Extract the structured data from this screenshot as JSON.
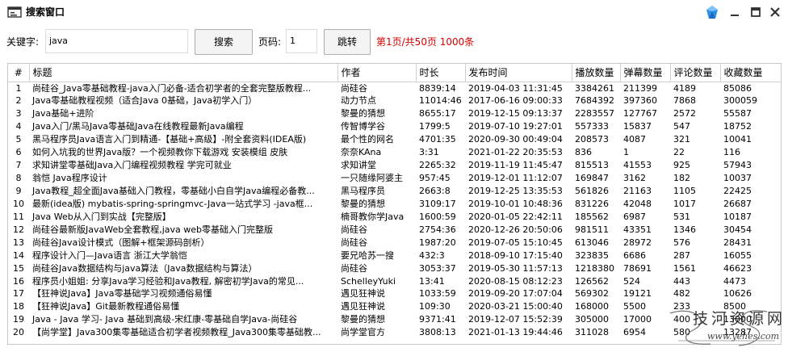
{
  "window": {
    "title": "搜索窗口"
  },
  "search": {
    "keyword_label": "关键字:",
    "keyword_value": "java",
    "search_button": "搜索",
    "page_label": "页码:",
    "page_value": "1",
    "jump_button": "跳转",
    "page_info": "第1页/共50页 1000条"
  },
  "table": {
    "columns": [
      "#",
      "标题",
      "作者",
      "时长",
      "发布时间",
      "播放数量",
      "弹幕数量",
      "评论数量",
      "收藏数量"
    ],
    "rows": [
      [
        "1",
        "尚硅谷_Java零基础教程-java入门必备-适合初学者的全套完整版教程...",
        "尚硅谷",
        "8839:14",
        "2019-04-03 11:31:45",
        "3384261",
        "211399",
        "4189",
        "85086"
      ],
      [
        "2",
        "Java零基础教程视频（适合Java 0基础，Java初学入门）",
        "动力节点",
        "11014:46",
        "2017-06-16 09:00:33",
        "7684392",
        "397360",
        "7868",
        "300059"
      ],
      [
        "3",
        "Java基础+进阶",
        "黎曼的猜想",
        "8655:17",
        "2019-12-15 09:13:37",
        "2283557",
        "127767",
        "2572",
        "55587"
      ],
      [
        "4",
        "Java入门/黑马Java零基础Java在线教程最新Java编程",
        "传智博学谷",
        "1799:5",
        "2019-07-10 19:27:01",
        "557333",
        "15837",
        "547",
        "18752"
      ],
      [
        "5",
        "黑马程序员Java语言入门到精通-【基础+高级】-附全套资料(IDEA版)",
        "最个性的网名",
        "4701:35",
        "2020-09-30 00:49:04",
        "208573",
        "4087",
        "321",
        "10041"
      ],
      [
        "6",
        "如何入坑我的世界Java版？一个视频教你下载游戏 安装模组 皮肤",
        "奈奈KAna",
        "3:31",
        "2021-01-22 20:35:53",
        "836",
        "1",
        "22",
        "116"
      ],
      [
        "7",
        "求知讲堂零基础Java入门编程视频教程 学完可就业",
        "求知讲堂",
        "2265:32",
        "2019-11-19 11:45:47",
        "815513",
        "41553",
        "925",
        "57943"
      ],
      [
        "8",
        "翁恺  Java程序设计",
        "一只随缘阿婆主",
        "957:45",
        "2019-12-01 11:12:07",
        "169847",
        "3162",
        "182",
        "10037"
      ],
      [
        "9",
        "Java教程_超全面Java基础入门教程，零基础小白自学Java编程必备教...",
        "黑马程序员",
        "2663:8",
        "2019-12-25 13:35:53",
        "561826",
        "21163",
        "1105",
        "22425"
      ],
      [
        "10",
        "最新(idea版) mybatis-spring-springmvc-Java一站式学习 -java框...",
        "黎曼的猜想",
        "3109:17",
        "2019-10-01 10:48:36",
        "831226",
        "42048",
        "1017",
        "26687"
      ],
      [
        "11",
        "Java Web从入门到实战【完整版】",
        "楠哥教你学Java",
        "1600:59",
        "2020-01-05 22:42:11",
        "185562",
        "6987",
        "531",
        "10187"
      ],
      [
        "12",
        "尚硅谷最新版JavaWeb全套教程,java web零基础入门完整版",
        "尚硅谷",
        "2754:36",
        "2020-12-26 20:50:06",
        "981511",
        "43351",
        "1346",
        "30454"
      ],
      [
        "13",
        "尚硅谷Java设计模式（图解+框架源码剖析）",
        "尚硅谷",
        "1987:20",
        "2019-07-05 15:10:45",
        "613046",
        "28972",
        "576",
        "28431"
      ],
      [
        "14",
        "程序设计入门—Java语言 浙江大学翁恺",
        "要兄哈苏一搜",
        "432:3",
        "2018-09-10 17:15:40",
        "323835",
        "6686",
        "287",
        "16055"
      ],
      [
        "15",
        "尚硅谷Java数据结构与java算法（Java数据结构与算法）",
        "尚硅谷",
        "3053:37",
        "2019-05-30 11:57:13",
        "1218380",
        "78691",
        "1561",
        "46623"
      ],
      [
        "16",
        "程序员小姐姐: 分享Java学习经验和Java教程, 解密初学Java的常见...",
        "SchelleyYuki",
        "13:41",
        "2020-08-15 08:12:23",
        "126562",
        "524",
        "443",
        "4473"
      ],
      [
        "17",
        "【狂神说Java】Java零基础学习视频通俗易懂",
        "遇见狂神说",
        "1033:59",
        "2019-09-20 17:07:04",
        "569302",
        "19121",
        "482",
        "10626"
      ],
      [
        "18",
        "【狂神说Java】Git最新教程通俗易懂",
        "遇见狂神说",
        "109:30",
        "2020-03-21 15:00:40",
        "168000",
        "5500",
        "233",
        "8500"
      ],
      [
        "19",
        "Java - Java 学习- Java 基础到高级-宋红康-零基础自学Java-尚硅谷",
        "黎曼的猜想",
        "9371:41",
        "2019-12-07 15:52:39",
        "305000",
        "17000",
        "400",
        "13000"
      ],
      [
        "20",
        "【尚学堂】Java300集零基础适合初学者视频教程_Java300集零基础教...",
        "尚学堂官方",
        "3808:13",
        "2021-01-13 19:44:46",
        "311028",
        "6954",
        "580",
        "13287"
      ]
    ]
  },
  "watermark": {
    "text": "技河资源网",
    "url": "www.yehes.com"
  },
  "icons": {
    "app": "window-app-icon",
    "gem": "gem-icon",
    "min": "minimize-icon",
    "max": "maximize-icon",
    "close": "close-icon"
  }
}
